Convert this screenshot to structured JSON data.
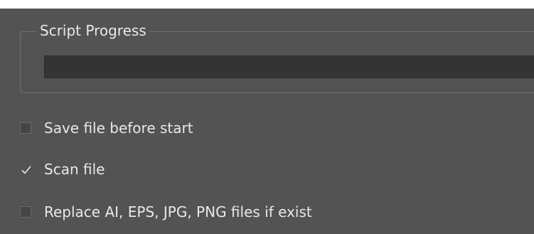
{
  "progress_group": {
    "title": "Script Progress",
    "progress_fraction": 0
  },
  "options": [
    {
      "label": "Save file before start",
      "checked": false
    },
    {
      "label": "Scan file",
      "checked": true
    },
    {
      "label": "Replace AI, EPS, JPG, PNG files if exist",
      "checked": false
    }
  ],
  "colors": {
    "panel_background": "#535353",
    "text": "#e8e8e8",
    "progress_track": "#343434"
  }
}
